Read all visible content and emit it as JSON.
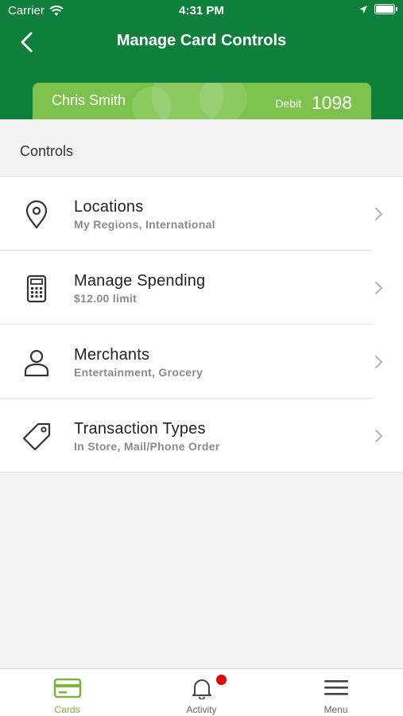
{
  "status_bar": {
    "carrier": "Carrier",
    "time": "4:31 PM"
  },
  "header": {
    "title": "Manage Card Controls",
    "back_icon": "chevron-left-icon",
    "background": "#0f7f3c"
  },
  "card": {
    "holder": "Chris Smith",
    "type": "Debit",
    "last4": "1098",
    "color": "#7cc24c"
  },
  "controls": {
    "section_label": "Controls",
    "items": [
      {
        "icon": "location-pin-icon",
        "title": "Locations",
        "subtitle": "My Regions, International"
      },
      {
        "icon": "calculator-icon",
        "title": "Manage Spending",
        "subtitle": "$12.00 limit"
      },
      {
        "icon": "person-icon",
        "title": "Merchants",
        "subtitle": "Entertainment, Grocery"
      },
      {
        "icon": "tag-icon",
        "title": "Transaction Types",
        "subtitle": "In Store, Mail/Phone Order"
      }
    ]
  },
  "tabbar": {
    "tabs": [
      {
        "label": "Cards",
        "icon": "card-icon",
        "active": true
      },
      {
        "label": "Activity",
        "icon": "bell-icon",
        "active": false,
        "badge": true
      },
      {
        "label": "Menu",
        "icon": "hamburger-icon",
        "active": false
      }
    ],
    "active_color": "#7cb342",
    "badge_color": "#e00000"
  }
}
